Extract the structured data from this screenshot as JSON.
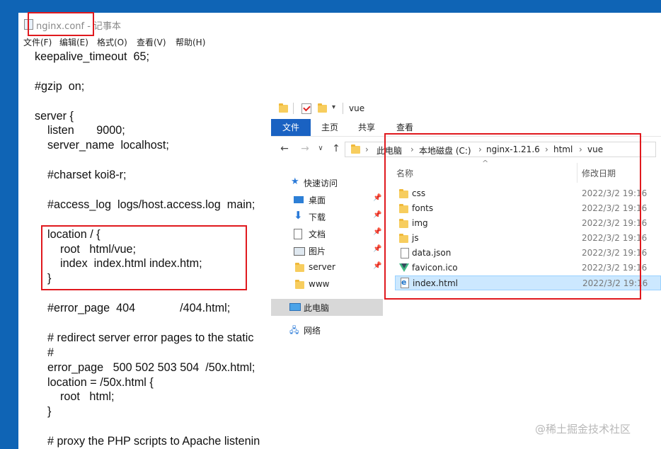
{
  "notepad": {
    "title": "nginx.conf - 记事本",
    "menu": [
      "文件(F)",
      "编辑(E)",
      "格式(O)",
      "查看(V)",
      "帮助(H)"
    ],
    "lines": [
      "keepalive_timeout  65;",
      "",
      "#gzip  on;",
      "",
      "server {",
      "    listen       9000;",
      "    server_name  localhost;",
      "",
      "    #charset koi8-r;",
      "",
      "    #access_log  logs/host.access.log  main;",
      "",
      "    location / {",
      "        root   html/vue;",
      "        index  index.html index.htm;",
      "    }",
      "",
      "    #error_page  404              /404.html;",
      "",
      "    # redirect server error pages to the static",
      "    #",
      "    error_page   500 502 503 504  /50x.html;",
      "    location = /50x.html {",
      "        root   html;",
      "    }",
      "",
      "    # proxy the PHP scripts to Apache listenin"
    ]
  },
  "explorer": {
    "title": "vue",
    "ribbon_tabs": [
      "文件",
      "主页",
      "共享",
      "查看"
    ],
    "breadcrumb": [
      "此电脑",
      "本地磁盘 (C:)",
      "nginx-1.21.6",
      "html",
      "vue"
    ],
    "nav": [
      {
        "label": "快速访问",
        "icon": "star-icon",
        "pinned": false
      },
      {
        "label": "桌面",
        "icon": "desktop-icon",
        "pinned": true
      },
      {
        "label": "下载",
        "icon": "download-icon",
        "pinned": true
      },
      {
        "label": "文档",
        "icon": "document-icon",
        "pinned": true
      },
      {
        "label": "图片",
        "icon": "picture-icon",
        "pinned": true
      },
      {
        "label": "server",
        "icon": "folder-icon",
        "pinned": true
      },
      {
        "label": "www",
        "icon": "folder-icon",
        "pinned": false
      },
      {
        "label": "此电脑",
        "icon": "computer-icon",
        "pinned": false
      },
      {
        "label": "网络",
        "icon": "network-icon",
        "pinned": false
      }
    ],
    "columns": {
      "name": "名称",
      "modified": "修改日期"
    },
    "files": [
      {
        "name": "css",
        "icon": "folder-icon",
        "date": "2022/3/2 19:16"
      },
      {
        "name": "fonts",
        "icon": "folder-icon",
        "date": "2022/3/2 19:16"
      },
      {
        "name": "img",
        "icon": "folder-icon",
        "date": "2022/3/2 19:16"
      },
      {
        "name": "js",
        "icon": "folder-icon",
        "date": "2022/3/2 19:16"
      },
      {
        "name": "data.json",
        "icon": "file-icon",
        "date": "2022/3/2 19:16"
      },
      {
        "name": "favicon.ico",
        "icon": "vue-icon",
        "date": "2022/3/2 19:16"
      },
      {
        "name": "index.html",
        "icon": "html-icon",
        "date": "2022/3/2 19:16"
      }
    ],
    "selected_file": "index.html"
  },
  "watermark": "@稀土掘金技术社区",
  "colors": {
    "desktop": "#0f64b5",
    "ribbon_active": "#1a62c2",
    "highlight": "#e0191e",
    "selection": "#cce8ff"
  }
}
